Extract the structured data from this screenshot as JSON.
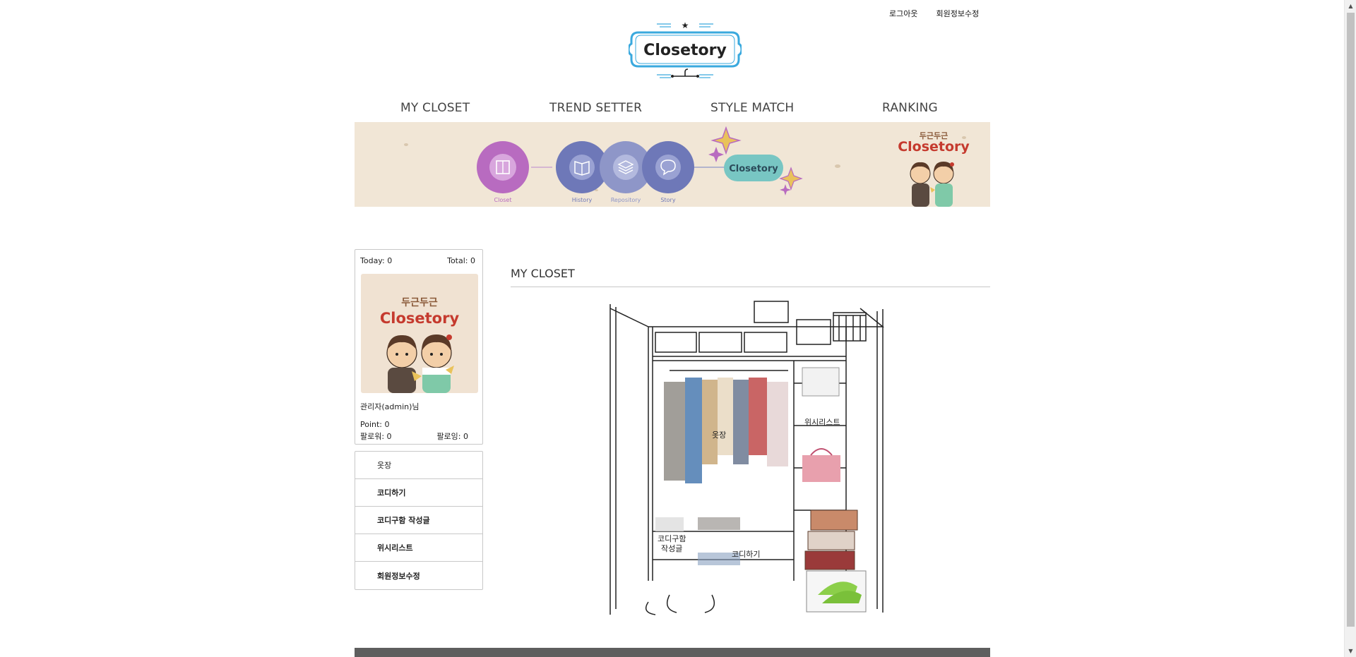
{
  "top_links": {
    "logout": "로그아웃",
    "edit_profile": "회원정보수정"
  },
  "logo": {
    "text": "Closetory"
  },
  "nav": {
    "items": [
      "MY CLOSET",
      "TREND SETTER",
      "STYLE MATCH",
      "RANKING"
    ]
  },
  "banner": {
    "steps": [
      "Closet",
      "History",
      "Repository",
      "Story"
    ],
    "badge": "Closetory",
    "brand_small": "두근두근",
    "brand_big": "Closetory"
  },
  "profile": {
    "today_label": "Today: 0",
    "total_label": "Total: 0",
    "avatar_small": "두근두근",
    "avatar_big": "Closetory",
    "username": "관리자(admin)님",
    "point": "Point: 0",
    "followers": "팔로워: 0",
    "following": "팔로잉: 0"
  },
  "sidemenu": {
    "items": [
      "옷장",
      "코디하기",
      "코디구함 작성글",
      "위시리스트",
      "회원정보수정"
    ]
  },
  "main": {
    "title": "MY CLOSET",
    "closet_labels": {
      "wardrobe": "옷장",
      "wishlist": "위시리스트",
      "request_line1": "코디구함",
      "request_line2": "작성글",
      "coordinate": "코디하기"
    }
  },
  "colors": {
    "accent_blue": "#3aa9de",
    "closet_purple": "#b86bc0",
    "step_blue": "#6e78b8",
    "badge_teal": "#78c6c3",
    "brand_red": "#c53a2e",
    "footer": "#5e5e5e"
  }
}
